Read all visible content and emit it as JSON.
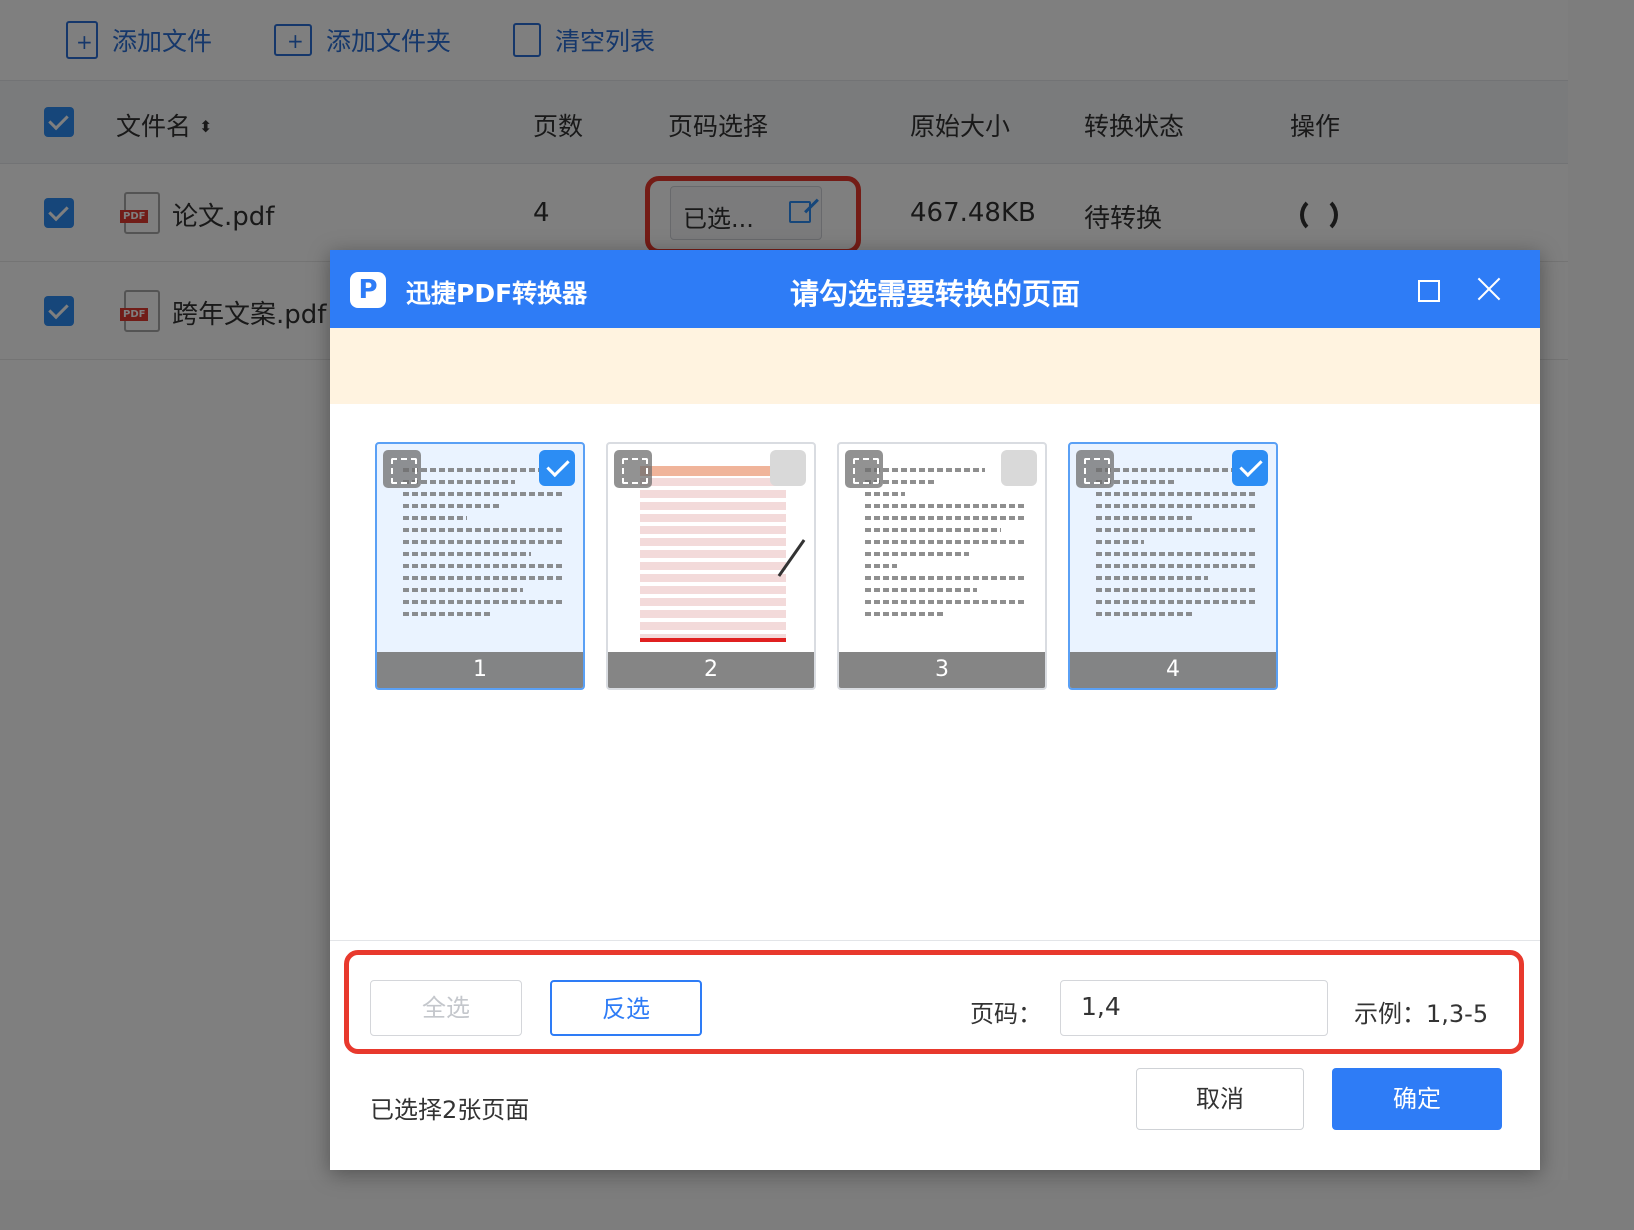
{
  "toolbar": {
    "add_file": "添加文件",
    "add_folder": "添加文件夹",
    "clear_list": "清空列表"
  },
  "table": {
    "headers": {
      "filename": "文件名",
      "pages": "页数",
      "page_select": "页码选择",
      "orig_size": "原始大小",
      "status": "转换状态",
      "action": "操作"
    },
    "rows": [
      {
        "name": "论文.pdf",
        "pages": "4",
        "page_select": "已选...",
        "size": "467.48KB",
        "status": "待转换"
      },
      {
        "name": "跨年文案.pdf"
      }
    ]
  },
  "dialog": {
    "app_name": "迅捷PDF转换器",
    "logo_letter": "P",
    "title": "请勾选需要转换的页面",
    "thumbnails": [
      {
        "page": "1",
        "checked": true
      },
      {
        "page": "2",
        "checked": false
      },
      {
        "page": "3",
        "checked": false
      },
      {
        "page": "4",
        "checked": true
      }
    ],
    "select_all": "全选",
    "invert": "反选",
    "page_label": "页码：",
    "page_value": "1,4",
    "example": "示例：1,3-5",
    "selected_summary": "已选择2张页面",
    "cancel": "取消",
    "confirm": "确定"
  },
  "colors": {
    "accent": "#2e7cf6",
    "checkbox": "#2c8df4",
    "highlight": "#e8392d",
    "notice_bg": "#fff3e0"
  },
  "icons": [
    "add-file-icon",
    "add-folder-icon",
    "trash-icon",
    "sort-icon",
    "pdf-file-icon",
    "edit-icon",
    "refresh-icon",
    "app-logo-icon",
    "maximize-icon",
    "close-icon",
    "expand-icon",
    "check-icon"
  ]
}
